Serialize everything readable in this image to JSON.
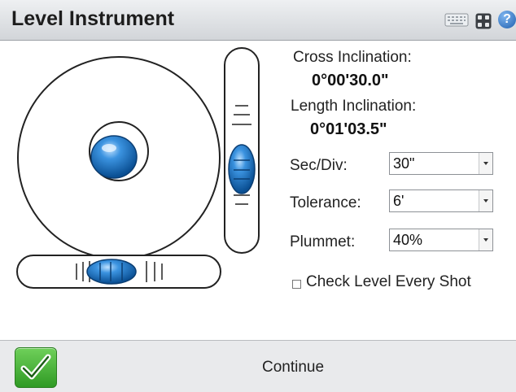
{
  "window": {
    "title": "Level Instrument"
  },
  "toolbar": {
    "icons": [
      "keyboard-icon",
      "grid-icon",
      "help-icon"
    ],
    "help_glyph": "?"
  },
  "readouts": {
    "cross_label": "Cross Inclination:",
    "cross_value": "0°00'30.0\"",
    "length_label": "Length Inclination:",
    "length_value": "0°01'03.5\""
  },
  "settings": {
    "sec_div": {
      "label": "Sec/Div:",
      "value": "30\""
    },
    "tolerance": {
      "label": "Tolerance:",
      "value": "6'"
    },
    "plummet": {
      "label": "Plummet:",
      "value": "40%"
    }
  },
  "check_level": {
    "label": "Check Level Every Shot",
    "checked": false
  },
  "footer": {
    "continue_label": "Continue"
  },
  "colors": {
    "bubble": "#1f77c7",
    "ok_green": "#3fae2e"
  }
}
